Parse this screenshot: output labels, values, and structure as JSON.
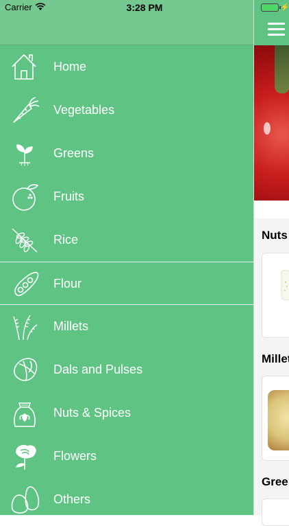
{
  "status_bar": {
    "carrier": "Carrier",
    "time": "3:28 PM"
  },
  "menu": {
    "items": [
      {
        "label": "Home",
        "icon": "home-icon"
      },
      {
        "label": "Vegetables",
        "icon": "carrot-icon"
      },
      {
        "label": "Greens",
        "icon": "sprout-icon"
      },
      {
        "label": "Fruits",
        "icon": "orange-icon"
      },
      {
        "label": "Rice",
        "icon": "rice-grain-icon"
      },
      {
        "label": "Flour",
        "icon": "pea-pod-icon"
      },
      {
        "label": "Millets",
        "icon": "millet-stalk-icon"
      },
      {
        "label": "Dals and Pulses",
        "icon": "hazelnut-icon"
      },
      {
        "label": "Nuts & Spices",
        "icon": "spice-sack-icon"
      },
      {
        "label": "Flowers",
        "icon": "rose-icon"
      },
      {
        "label": "Others",
        "icon": "eggs-icon"
      }
    ],
    "selected_index": 5
  },
  "main": {
    "sections": [
      "Nuts",
      "Millet",
      "Gree"
    ]
  },
  "colors": {
    "drawer_bg": "#5fc383",
    "header_bg": "#75c990",
    "text": "#ffffff"
  }
}
